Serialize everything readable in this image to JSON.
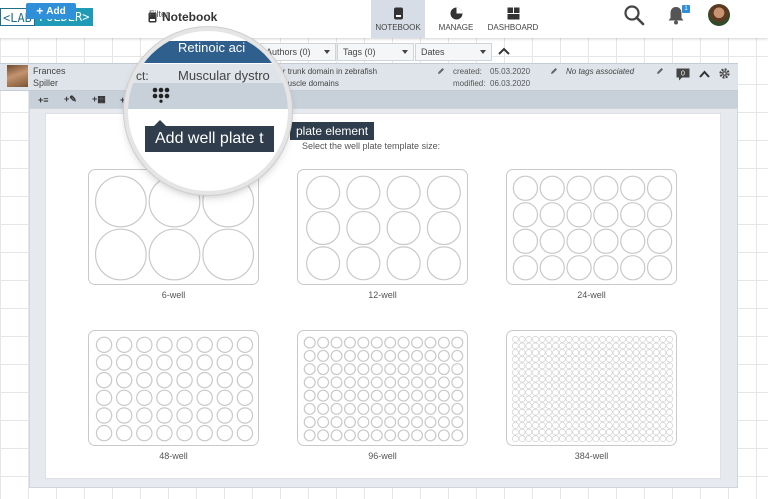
{
  "brand": {
    "logo_left": "<LAB",
    "logo_right": "FOLDER>"
  },
  "header": {
    "notebook_title": "Notebook"
  },
  "nav": {
    "notebook": "NOTEBOOK",
    "manage": "MANAGE",
    "dashboard": "DASHBOARD"
  },
  "notifications": {
    "count": "1"
  },
  "actions": {
    "add_label": "Add"
  },
  "filters": {
    "label": "Filter",
    "projects": "Retinoic acid",
    "authors": "Authors (0)",
    "tags": "Tags (0)",
    "dates": "Dates"
  },
  "entry": {
    "author_first": "Frances",
    "author_last": "Spiller",
    "project_label": "Project",
    "title_line1": "Muscular dystrophy the anterior trunk domain in zebrafish",
    "title_line1_visible": "the anterior trunk domain in zebrafish",
    "title_line2_visible": "of distinct muscle domains",
    "created_label": "created:",
    "created_value": "05.03.2020",
    "modified_label": "modified:",
    "modified_value": "06.03.2020",
    "no_tags": "No tags associated",
    "comment_count": "0"
  },
  "toolbar": {
    "buttons": [
      {
        "name": "add-text-button",
        "label": "+≡"
      },
      {
        "name": "add-sketch-button",
        "label": "+✎"
      },
      {
        "name": "add-table-button",
        "label": "+▦"
      },
      {
        "name": "add-file-button",
        "label": "+"
      }
    ]
  },
  "dialog": {
    "heading": "plate element",
    "subtitle": "Select the well plate template size:"
  },
  "tooltip": {
    "text": "Add well plate t"
  },
  "magnifier": {
    "filter_text": "Retinoic aci",
    "title_text": "Muscular dystro",
    "project_text": "ct:"
  },
  "plates": [
    {
      "label": "6-well",
      "rows": 2,
      "cols": 3
    },
    {
      "label": "12-well",
      "rows": 3,
      "cols": 4
    },
    {
      "label": "24-well",
      "rows": 4,
      "cols": 6
    },
    {
      "label": "48-well",
      "rows": 6,
      "cols": 8
    },
    {
      "label": "96-well",
      "rows": 8,
      "cols": 12
    },
    {
      "label": "384-well",
      "rows": 16,
      "cols": 24
    }
  ],
  "colors": {
    "accent": "#2f8fd8",
    "filter_active": "#2f5f8c",
    "tooltip_bg": "#2f3d4c"
  },
  "icons": {
    "search": "search-icon",
    "bell": "bell-icon",
    "gear": "gear-icon",
    "comment": "comment-icon",
    "chevron": "chevron-up-icon",
    "pencil": "pencil-icon",
    "wellplate": "well-plate-icon"
  }
}
